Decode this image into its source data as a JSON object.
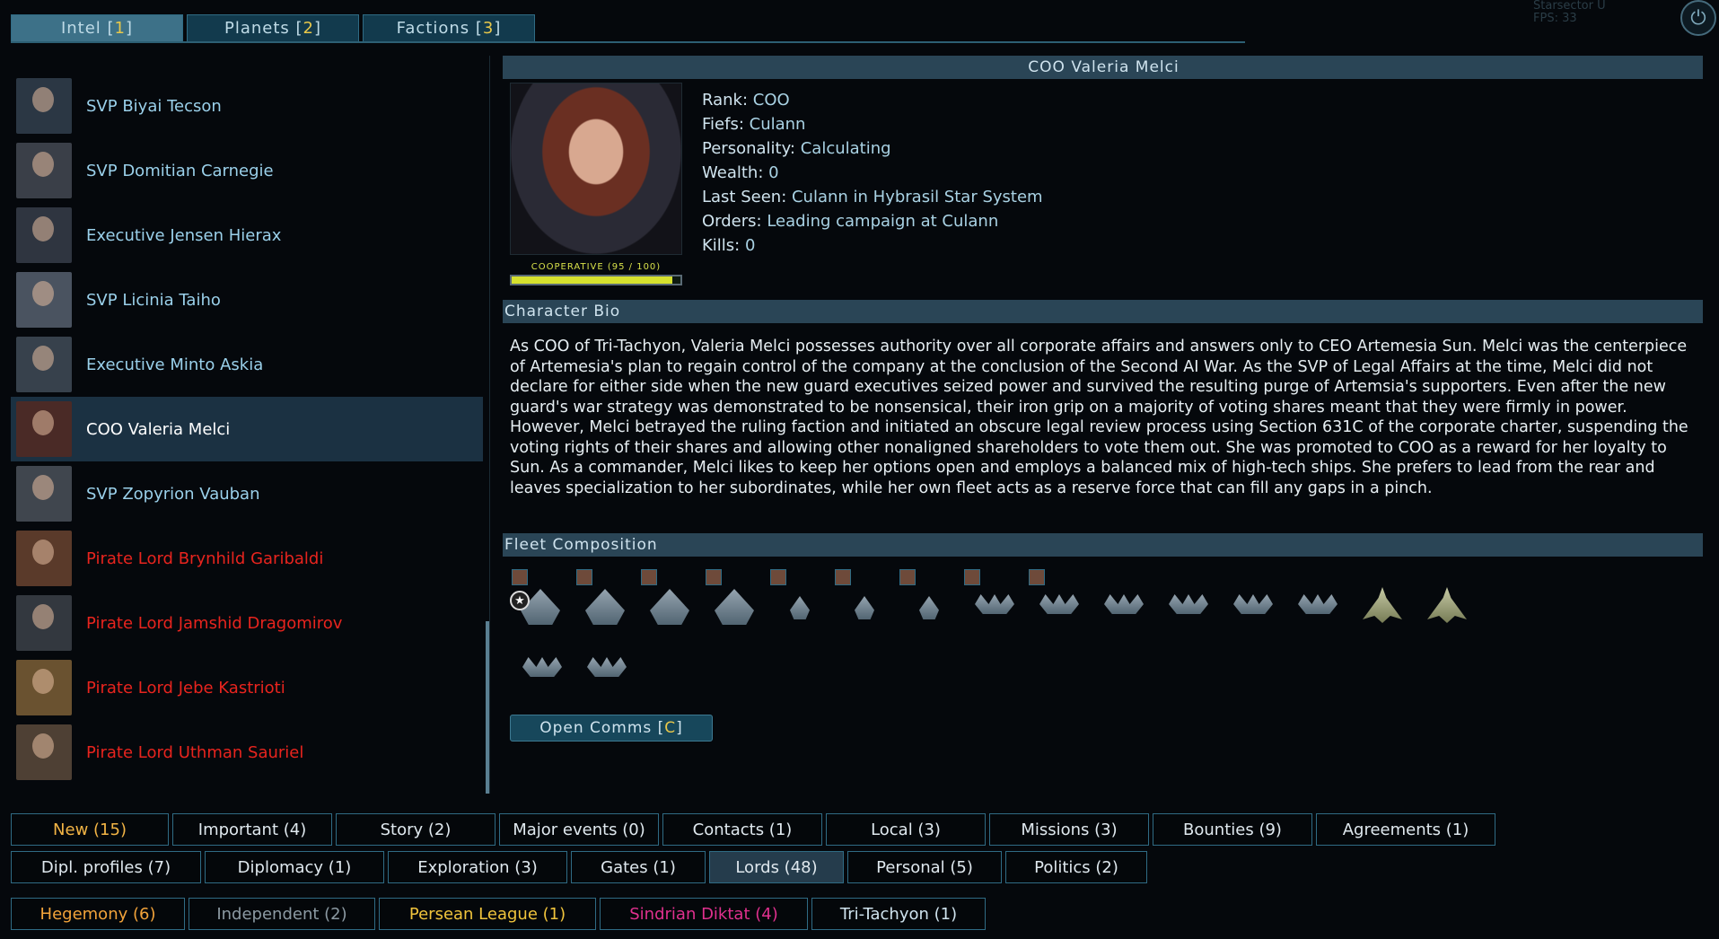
{
  "tabs": [
    {
      "label": "Intel [",
      "key": "1",
      "end": "]"
    },
    {
      "label": "Planets [",
      "key": "2",
      "end": "]"
    },
    {
      "label": "Factions [",
      "key": "3",
      "end": "]"
    }
  ],
  "overlay": {
    "line1": "Starsector U",
    "line2": "FPS: 33"
  },
  "lords": [
    {
      "name": "SVP Biyai Tecson",
      "color": "#9ad0ea"
    },
    {
      "name": "SVP Domitian Carnegie",
      "color": "#9ad0ea"
    },
    {
      "name": "Executive Jensen Hierax",
      "color": "#9ad0ea"
    },
    {
      "name": "SVP Licinia Taiho",
      "color": "#9ad0ea"
    },
    {
      "name": "Executive Minto Askia",
      "color": "#9ad0ea"
    },
    {
      "name": "COO Valeria Melci",
      "color": "#ffffff"
    },
    {
      "name": "SVP Zopyrion Vauban",
      "color": "#9ad0ea"
    },
    {
      "name": "Pirate Lord Brynhild Garibaldi",
      "color": "#e8241e"
    },
    {
      "name": "Pirate Lord Jamshid Dragomirov",
      "color": "#e8241e"
    },
    {
      "name": "Pirate Lord Jebe Kastrioti",
      "color": "#e8241e"
    },
    {
      "name": "Pirate Lord Uthman Sauriel",
      "color": "#e8241e"
    }
  ],
  "detail": {
    "title": "COO Valeria Melci",
    "relation": "COOPERATIVE (95 / 100)",
    "relation_value": 0.95,
    "stats": [
      {
        "label": "Rank: ",
        "value": "COO"
      },
      {
        "label": "Fiefs: ",
        "value": "Culann"
      },
      {
        "label": "Personality: ",
        "value": "Calculating"
      },
      {
        "label": "Wealth: ",
        "value": "0"
      },
      {
        "label": "Last Seen: ",
        "value": "Culann in Hybrasil Star System"
      },
      {
        "label": "Orders: ",
        "value": "Leading campaign at Culann"
      },
      {
        "label": "Kills: ",
        "value": "0"
      }
    ],
    "bio_header": "Character Bio",
    "bio": "As COO of Tri-Tachyon, Valeria Melci possesses authority over all corporate affairs and answers only to CEO Artemesia Sun. Melci was the centerpiece of Artemesia's plan to regain control of the company at the conclusion of the Second AI War. As the SVP of Legal Affairs at the time, Melci did not declare for either side when the new guard executives seized power and survived the resulting purge of Artemsia's supporters. Even after the new guard's war strategy was demonstrated to be nonsensical, their iron grip on a majority of voting shares meant that they were firmly in power. However, Melci betrayed the ruling faction and initiated an obscure legal review process using Section 631C of the corporate charter, suspending the voting rights of their shares and allowing other nonaligned shareholders to vote them out. She was promoted to COO as a reward for her loyalty to Sun. As a commander, Melci likes to keep her options open and employs a balanced mix of high-tech ships. She prefers to lead from the rear and leaves specialization to her subordinates, while her own fleet acts as a reserve force that can fill any gaps in a pinch.",
    "fleet_header": "Fleet Composition",
    "open_comms": {
      "label": "Open Comms [",
      "key": "C",
      "end": "]"
    }
  },
  "filters_row1": [
    {
      "label": "New (15)",
      "kind": "new"
    },
    {
      "label": "Important (4)"
    },
    {
      "label": "Story (2)"
    },
    {
      "label": "Major events (0)"
    },
    {
      "label": "Contacts (1)"
    },
    {
      "label": "Local (3)"
    },
    {
      "label": "Missions (3)"
    },
    {
      "label": "Bounties (9)"
    },
    {
      "label": "Agreements (1)"
    }
  ],
  "filters_row2": [
    {
      "label": "Dipl. profiles (7)"
    },
    {
      "label": "Diplomacy (1)"
    },
    {
      "label": "Exploration (3)"
    },
    {
      "label": "Gates (1)"
    },
    {
      "label": "Lords (48)",
      "kind": "active"
    },
    {
      "label": "Personal (5)"
    },
    {
      "label": "Politics (2)"
    }
  ],
  "filters_row3": [
    {
      "label": "Hegemony (6)",
      "kind": "hegemony"
    },
    {
      "label": "Independent (2)",
      "kind": "independent"
    },
    {
      "label": "Persean League (1)",
      "kind": "persean"
    },
    {
      "label": "Sindrian Diktat (4)",
      "kind": "sindrian"
    },
    {
      "label": "Tri-Tachyon (1)",
      "kind": "tritach"
    }
  ],
  "colors": {
    "accent": "#2f6b84",
    "highlight": "#e8c84a",
    "hostile": "#e8241e",
    "friendly": "#9ad0ea"
  }
}
